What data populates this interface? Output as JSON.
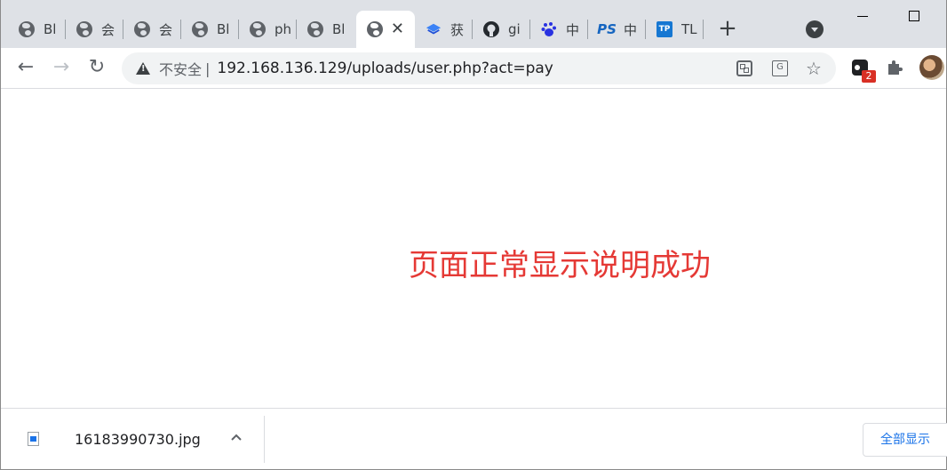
{
  "tabs": [
    {
      "label": "Bl",
      "icon": "globe-icon"
    },
    {
      "label": "会",
      "icon": "globe-icon"
    },
    {
      "label": "会",
      "icon": "globe-icon"
    },
    {
      "label": "Bl",
      "icon": "globe-icon"
    },
    {
      "label": "ph",
      "icon": "globe-icon"
    },
    {
      "label": "Bl",
      "icon": "globe-icon"
    },
    {
      "label": "",
      "icon": "globe-icon",
      "active": true,
      "close": "✕"
    },
    {
      "label": "获",
      "icon": "layers-icon"
    },
    {
      "label": "gi",
      "icon": "github-icon"
    },
    {
      "label": "中",
      "icon": "baidu-icon"
    },
    {
      "label": "中",
      "icon": "ps-icon"
    },
    {
      "label": "TL",
      "icon": "tp-icon"
    }
  ],
  "tab_icon_text": {
    "ps": "PS",
    "tp": "TP"
  },
  "new_tab": "+",
  "toolbar": {
    "back": "←",
    "forward": "→",
    "reload": "↻"
  },
  "omnibox": {
    "security_text": "不安全",
    "divider": "|",
    "url": "192.168.136.129/uploads/user.php?act=pay",
    "translate_glyph": "G",
    "star_glyph": "☆"
  },
  "extensions": {
    "badge_count": "2",
    "puzzle_glyph": "✱"
  },
  "page": {
    "message": "页面正常显示说明成功",
    "message_color": "#e53935"
  },
  "download_shelf": {
    "file_name": "16183990730.jpg",
    "menu_glyph": "^",
    "show_all": "全部显示"
  },
  "colors": {
    "tabstrip": "#dee1e6",
    "accent": "#1a73e8",
    "badge": "#d93025"
  }
}
